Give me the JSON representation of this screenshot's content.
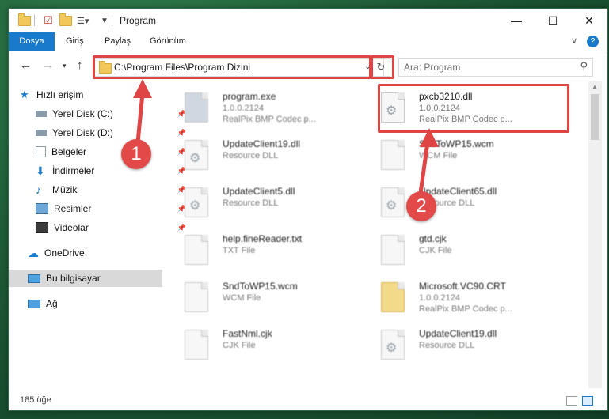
{
  "window": {
    "title": "Program",
    "controls": {
      "minimize": "—",
      "maximize": "☐",
      "close": "✕"
    }
  },
  "ribbon": {
    "tabs": [
      "Dosya",
      "Giriş",
      "Paylaş",
      "Görünüm"
    ],
    "help_icon": "?",
    "collapse_icon": "∨"
  },
  "address_bar": {
    "path": "C:\\Program Files\\Program Dizini",
    "search_placeholder": "Ara: Program"
  },
  "nav_pane": {
    "quick_access": "Hızlı erişim",
    "items": [
      "Yerel Disk (C:)",
      "Yerel Disk (D:)",
      "Belgeler",
      "İndirmeler",
      "Müzik",
      "Resimler",
      "Videolar"
    ],
    "onedrive": "OneDrive",
    "this_pc": "Bu bilgisayar",
    "network": "Ağ"
  },
  "files": [
    {
      "name": "program.exe",
      "line1": "1.0.0.2124",
      "line2": "RealPix BMP Codec p...",
      "icon": "exe-icon"
    },
    {
      "name": "pxcb3210.dll",
      "line1": "1.0.0.2124",
      "line2": "RealPix BMP Codec p...",
      "icon": "dll-gear-icon"
    },
    {
      "name": "UpdateClient19.dll",
      "line1": "Resource DLL",
      "line2": "",
      "icon": "dll-gear-icon"
    },
    {
      "name": "SndToWP15.wcm",
      "line1": "WCM File",
      "line2": "",
      "icon": "file-icon"
    },
    {
      "name": "UpdateClient5.dll",
      "line1": "Resource DLL",
      "line2": "",
      "icon": "dll-gear-icon"
    },
    {
      "name": "UpdateClient65.dll",
      "line1": "Resource DLL",
      "line2": "",
      "icon": "dll-gear-icon"
    },
    {
      "name": "help.fineReader.txt",
      "line1": "TXT File",
      "line2": "",
      "icon": "file-icon"
    },
    {
      "name": "gtd.cjk",
      "line1": "CJK File",
      "line2": "",
      "icon": "file-icon"
    },
    {
      "name": "SndToWP15.wcm",
      "line1": "WCM File",
      "line2": "",
      "icon": "file-icon"
    },
    {
      "name": "Microsoft.VC90.CRT",
      "line1": "1.0.0.2124",
      "line2": "RealPix BMP Codec p...",
      "icon": "folder-icon"
    },
    {
      "name": "FastNml.cjk",
      "line1": "CJK File",
      "line2": "",
      "icon": "file-icon"
    },
    {
      "name": "UpdateClient19.dll",
      "line1": "Resource DLL",
      "line2": "",
      "icon": "dll-gear-icon"
    }
  ],
  "status_bar": {
    "count": "185 öğe"
  },
  "annotations": {
    "marker1": "1",
    "marker2": "2",
    "color": "#e04545"
  },
  "colors": {
    "accent": "#1979ca",
    "selected_nav": "#d9d9d9"
  }
}
